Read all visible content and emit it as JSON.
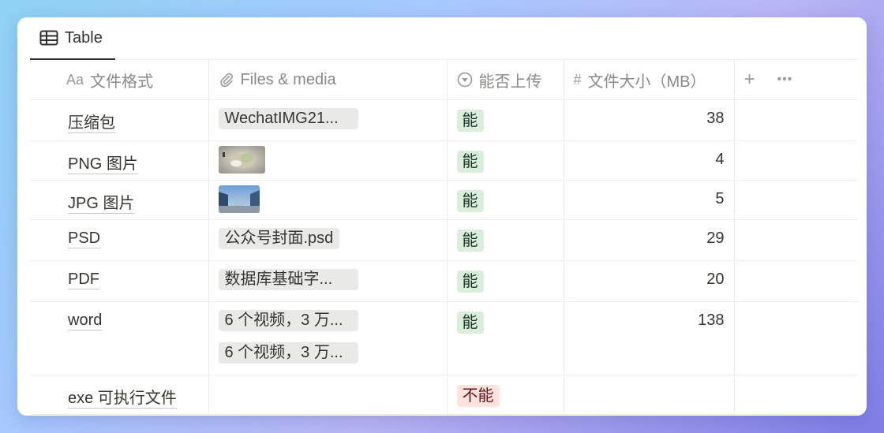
{
  "tab": {
    "label": "Table",
    "icon": "table-icon"
  },
  "columns": [
    {
      "label": "文件格式",
      "icon_text": "Aa"
    },
    {
      "label": "Files & media",
      "icon": "paperclip-icon"
    },
    {
      "label": "能否上传",
      "icon": "select-icon"
    },
    {
      "label": "文件大小（MB）",
      "icon_text": "#"
    }
  ],
  "add_column": {
    "plus": "+",
    "more": "•••"
  },
  "rows": [
    {
      "name": "压缩包",
      "files": [
        "WechatIMG21..."
      ],
      "status": "能",
      "size": "38"
    },
    {
      "name": "PNG 图片",
      "thumb": "png-thumbnail",
      "status": "能",
      "size": "4"
    },
    {
      "name": "JPG 图片",
      "thumb": "jpg-thumbnail",
      "status": "能",
      "size": "5"
    },
    {
      "name": "PSD",
      "files": [
        "公众号封面.psd"
      ],
      "status": "能",
      "size": "29"
    },
    {
      "name": "PDF",
      "files": [
        "数据库基础字..."
      ],
      "status": "能",
      "size": "20"
    },
    {
      "name": "word",
      "files": [
        "6 个视频，3 万...",
        "6 个视频，3 万..."
      ],
      "status": "能",
      "size": "138"
    },
    {
      "name": "exe 可执行文件",
      "files": [],
      "status": "不能",
      "size": ""
    }
  ],
  "colors": {
    "yes_bg": "#dbeddb",
    "no_bg": "#ffe2dd",
    "accent_underline": "#2f2f2f"
  }
}
